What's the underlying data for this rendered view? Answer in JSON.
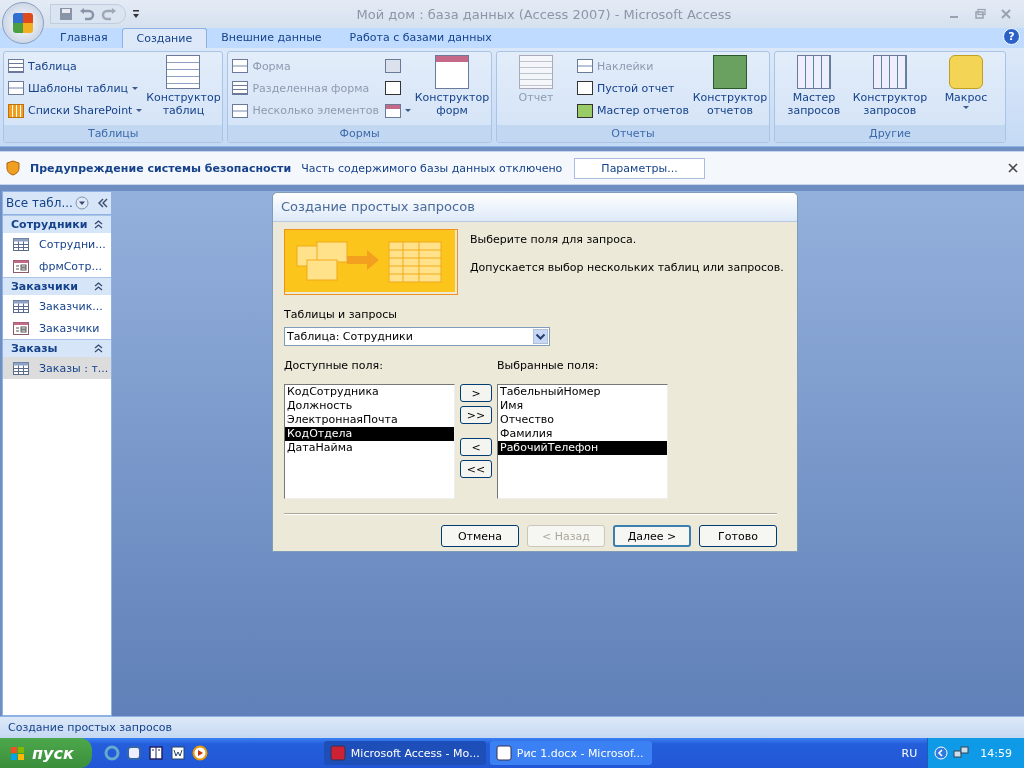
{
  "window": {
    "title": "Мой дом : база данных (Access 2007) - Microsoft Access"
  },
  "tabs": [
    {
      "label": "Главная",
      "selected": false
    },
    {
      "label": "Создание",
      "selected": true
    },
    {
      "label": "Внешние данные",
      "selected": false
    },
    {
      "label": "Работа с базами данных",
      "selected": false
    }
  ],
  "help_button": "?",
  "ribbon": [
    {
      "label": "Таблицы",
      "columns": [
        {
          "kind": "stack",
          "items": [
            {
              "label": "Таблица",
              "disabled": false,
              "dropdown": false
            },
            {
              "label": "Шаблоны таблиц",
              "disabled": false,
              "dropdown": true
            },
            {
              "label": "Списки SharePoint",
              "disabled": false,
              "dropdown": true
            }
          ]
        },
        {
          "kind": "large",
          "label": "Конструктор таблиц",
          "disabled": false,
          "dropdown": false
        }
      ]
    },
    {
      "label": "Формы",
      "columns": [
        {
          "kind": "stack",
          "items": [
            {
              "label": "Форма",
              "disabled": true,
              "dropdown": false
            },
            {
              "label": "Разделенная форма",
              "disabled": true,
              "dropdown": false
            },
            {
              "label": "Несколько элементов",
              "disabled": true,
              "dropdown": false
            }
          ]
        },
        {
          "kind": "icons",
          "items": [
            {
              "dropdown": false
            },
            {
              "dropdown": false
            },
            {
              "dropdown": true
            }
          ]
        },
        {
          "kind": "large",
          "label": "Конструктор форм",
          "disabled": false,
          "dropdown": false
        }
      ]
    },
    {
      "label": "Отчеты",
      "columns": [
        {
          "kind": "large",
          "label": "Отчет",
          "disabled": true,
          "dropdown": false
        },
        {
          "kind": "stack",
          "items": [
            {
              "label": "Наклейки",
              "disabled": true,
              "dropdown": false
            },
            {
              "label": "Пустой отчет",
              "disabled": false,
              "dropdown": false
            },
            {
              "label": "Мастер отчетов",
              "disabled": false,
              "dropdown": false
            }
          ]
        },
        {
          "kind": "large",
          "label": "Конструктор отчетов",
          "disabled": false,
          "dropdown": false
        }
      ]
    },
    {
      "label": "Другие",
      "columns": [
        {
          "kind": "large",
          "label": "Мастер запросов",
          "disabled": false,
          "dropdown": false
        },
        {
          "kind": "large",
          "label": "Конструктор запросов",
          "disabled": false,
          "dropdown": false
        },
        {
          "kind": "large",
          "label": "Макрос",
          "disabled": false,
          "dropdown": true
        }
      ]
    }
  ],
  "security_bar": {
    "title": "Предупреждение системы безопасности",
    "message": "Часть содержимого базы данных отключено",
    "button": "Параметры..."
  },
  "nav_pane": {
    "header": "Все табл...",
    "groups": [
      {
        "label": "Сотрудники",
        "items": [
          {
            "label": "Сотрудни...",
            "kind": "table",
            "selected": false
          },
          {
            "label": "фрмСотр...",
            "kind": "form",
            "selected": false
          }
        ]
      },
      {
        "label": "Заказчики",
        "items": [
          {
            "label": "Заказчик...",
            "kind": "table",
            "selected": false
          },
          {
            "label": "Заказчики",
            "kind": "form",
            "selected": false
          }
        ]
      },
      {
        "label": "Заказы",
        "items": [
          {
            "label": "Заказы : т...",
            "kind": "table",
            "selected": true
          }
        ]
      }
    ]
  },
  "dialog": {
    "title": "Создание простых запросов",
    "messages": [
      "Выберите поля для запроса.",
      "Допускается выбор нескольких таблиц или запросов."
    ],
    "source_label": "Таблицы и запросы",
    "source_value": "Таблица: Сотрудники",
    "available_label": "Доступные поля:",
    "available": [
      {
        "label": "КодСотрудника",
        "selected": false
      },
      {
        "label": "Должность",
        "selected": false
      },
      {
        "label": "ЭлектроннаяПочта",
        "selected": false
      },
      {
        "label": "КодОтдела",
        "selected": true
      },
      {
        "label": "ДатаНайма",
        "selected": false
      }
    ],
    "chosen_label": "Выбранные поля:",
    "chosen": [
      {
        "label": "ТабельныйНомер",
        "selected": false
      },
      {
        "label": "Имя",
        "selected": false
      },
      {
        "label": "Отчество",
        "selected": false
      },
      {
        "label": "Фамилия",
        "selected": false
      },
      {
        "label": "РабочийТелефон",
        "selected": true
      }
    ],
    "move_buttons": [
      ">",
      ">>",
      "<",
      "<<"
    ],
    "buttons": [
      {
        "label": "Отмена",
        "disabled": false,
        "default": false
      },
      {
        "label": "< Назад",
        "disabled": true,
        "default": false
      },
      {
        "label": "Далее >",
        "disabled": false,
        "default": true
      },
      {
        "label": "Готово",
        "disabled": false,
        "default": false
      }
    ]
  },
  "status_bar": {
    "text": "Создание простых запросов"
  },
  "taskbar": {
    "start": "пуск",
    "windows": [
      {
        "label": "Microsoft Access - Мо...",
        "selected": true
      },
      {
        "label": "Рис 1.docx - Microsof...",
        "selected": false
      }
    ],
    "language": "RU",
    "clock": "14:59"
  }
}
